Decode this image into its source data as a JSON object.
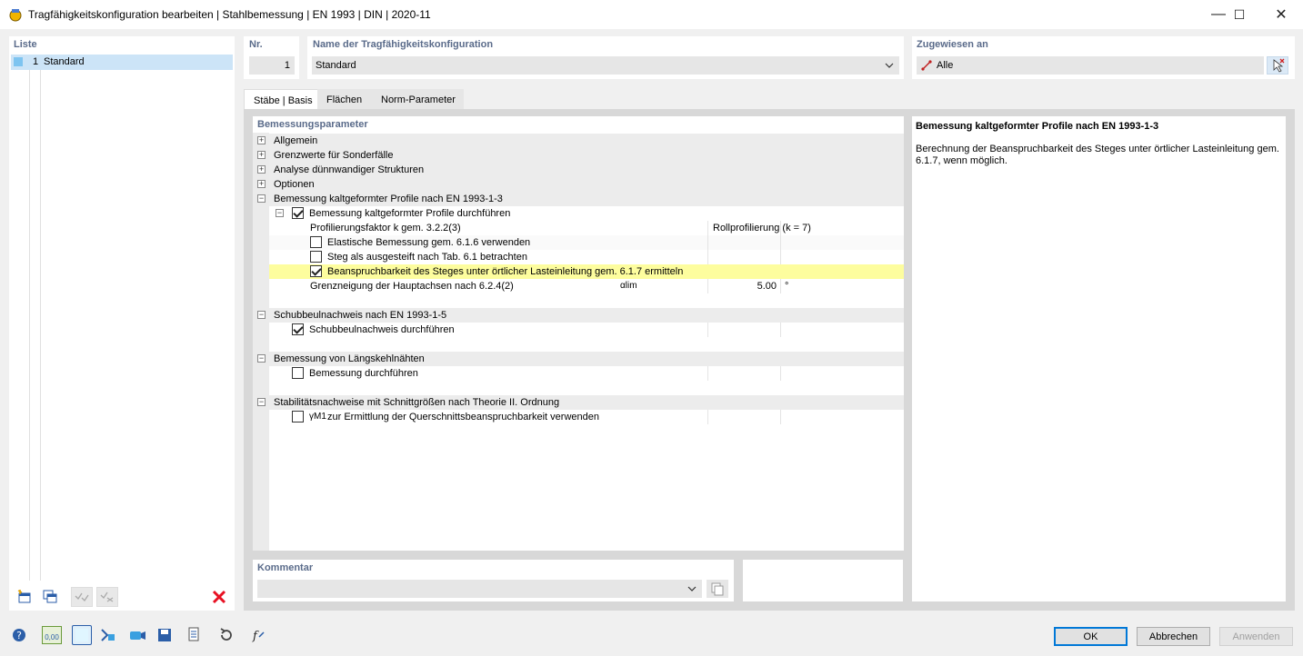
{
  "window": {
    "title": "Tragfähigkeitskonfiguration bearbeiten | Stahlbemessung | EN 1993 | DIN | 2020-11",
    "minimize_glyph": "—",
    "maximize_glyph": "☐",
    "close_glyph": "✕"
  },
  "list": {
    "header": "Liste",
    "items": [
      {
        "nr": "1",
        "label": "Standard"
      }
    ]
  },
  "nr": {
    "header": "Nr.",
    "value": "1"
  },
  "name": {
    "header": "Name der Tragfähigkeitskonfiguration",
    "value": "Standard"
  },
  "assigned": {
    "header": "Zugewiesen an",
    "value": "Alle"
  },
  "tabs": [
    {
      "label": "Stäbe | Basis",
      "active": true
    },
    {
      "label": "Flächen",
      "active": false
    },
    {
      "label": "Norm-Parameter",
      "active": false
    }
  ],
  "params": {
    "header": "Bemessungsparameter",
    "groups": {
      "allgemein": "Allgemein",
      "grenzwerte": "Grenzwerte für Sonderfälle",
      "analyse": "Analyse dünnwandiger Strukturen",
      "optionen": "Optionen",
      "kaltgeformt": "Bemessung kaltgeformter Profile nach EN 1993-1-3",
      "schubbeul": "Schubbeulnachweis nach EN 1993-1-5",
      "laengskehl": "Bemessung von Längskehlnähten",
      "stabilitaet": "Stabilitätsnachweise mit Schnittgrößen nach Theorie II. Ordnung"
    },
    "rows": {
      "kalt_durchfuehren": "Bemessung kaltgeformter Profile durchführen",
      "profilierungsfaktor": "Profilierungsfaktor k gem. 3.2.2(3)",
      "profilierungsfaktor_value": "Rollprofilierung (k = 7)",
      "elastische": "Elastische Bemessung gem. 6.1.6 verwenden",
      "steg": "Steg als ausgesteift nach Tab. 6.1 betrachten",
      "beanspruchbarkeit": "Beanspruchbarkeit des Steges unter örtlicher Lasteinleitung gem. 6.1.7 ermitteln",
      "grenzneigung": "Grenzneigung der Hauptachsen nach 6.2.4(2)",
      "grenzneigung_symbol": "αlim",
      "grenzneigung_value": "5.00",
      "grenzneigung_unit": "°",
      "schubbeul_durchfuehren": "Schubbeulnachweis durchführen",
      "laengs_durchfuehren": "Bemessung durchführen",
      "gamma_symbol": "γM1",
      "gamma_text": "zur Ermittlung der Querschnittsbeanspruchbarkeit verwenden"
    },
    "checks": {
      "kalt_durchfuehren": true,
      "elastische": false,
      "steg": false,
      "beanspruchbarkeit": true,
      "schubbeul_durchfuehren": true,
      "laengs_durchfuehren": false,
      "gamma": false
    }
  },
  "info": {
    "title": "Bemessung kaltgeformter Profile nach EN 1993-1-3",
    "text": "Berechnung der Beanspruchbarkeit des Steges unter örtlicher Lasteinleitung gem. 6.1.7, wenn möglich."
  },
  "comment": {
    "header": "Kommentar",
    "value": ""
  },
  "buttons": {
    "ok": "OK",
    "cancel": "Abbrechen",
    "apply": "Anwenden"
  },
  "toolbar_readout": "0,00",
  "colors": {
    "accent": "#0078d7",
    "highlight": "#fdfd9e",
    "header_text": "#5a6b8a",
    "delete_red": "#e81123"
  }
}
